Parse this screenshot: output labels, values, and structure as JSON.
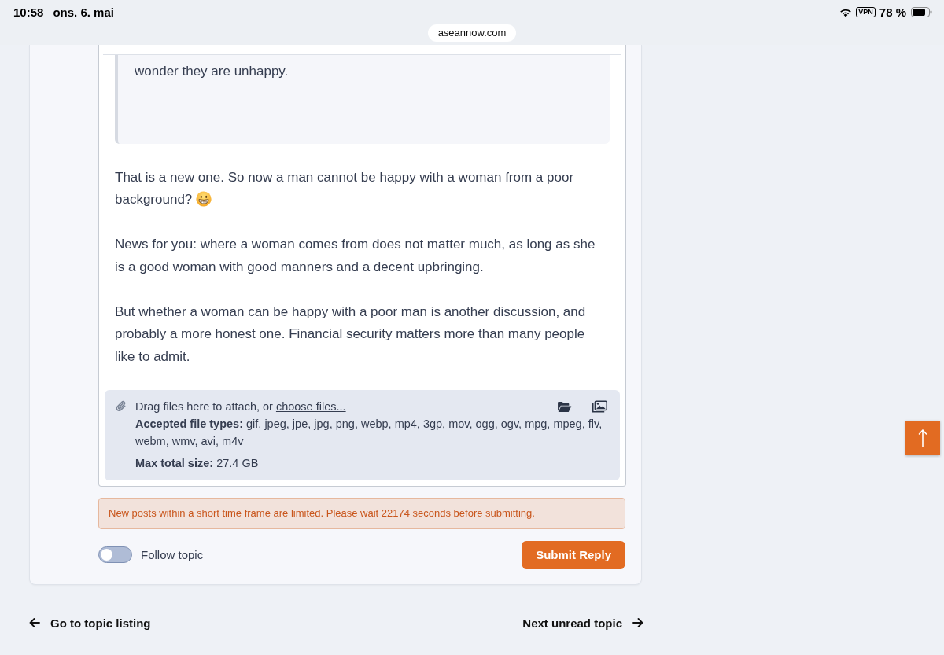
{
  "status_bar": {
    "time": "10:58",
    "date": "ons. 6. mai",
    "vpn_badge": "VPN",
    "battery_percent": "78 %"
  },
  "address_bar": {
    "url": "aseannow.com"
  },
  "editor": {
    "quote": "wonder they are unhappy.",
    "paragraphs": [
      {
        "text": "That is a new one. So now a man cannot be happy with a woman from a poor background?",
        "emoji": true
      },
      {
        "text": "News for you: where a woman comes from does not matter much, as long as she is a good woman with good manners and a decent upbringing.",
        "emoji": false
      },
      {
        "text": "But whether a woman can be happy with a poor man is another discussion, and probably a more honest one. Financial security matters more than many people like to admit.",
        "emoji": false
      }
    ],
    "attachments": {
      "hint": "Drag files here to attach, or",
      "link": "choose files...",
      "accepted": "**Accepted file types:** gif, jpeg, jpe, jpg, png, webp, mp4, 3gp, mov, ogg, ogv, mpg, mpeg, flv, webm, wmv, avi, m4v",
      "max_size": "**Max total size:** 27.4 GB"
    }
  },
  "notice": "New posts within a short time frame are limited. Please wait 22174 seconds before submitting.",
  "follow": {
    "label": "Follow topic",
    "on": false
  },
  "submit_button": "Submit Reply",
  "navigation": {
    "previous": "Go to topic listing",
    "next": "Next unread topic"
  }
}
